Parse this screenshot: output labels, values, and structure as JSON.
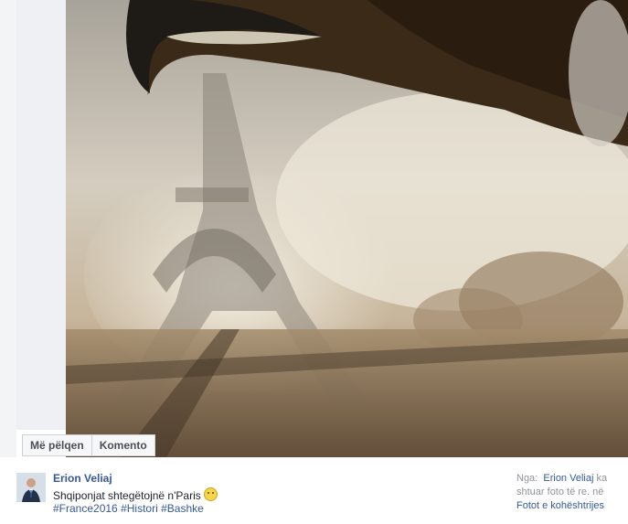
{
  "photo": {
    "description_alt": ""
  },
  "actions": {
    "like_label": "Më pëlqen",
    "comment_label": "Komento"
  },
  "post": {
    "author": "Erion Veliaj",
    "caption": "Shqiponjat shtegëtojnë n'Paris",
    "tags": [
      "#France2016",
      "#Histori",
      "#Bashke"
    ]
  },
  "source": {
    "label": "Nga:",
    "author": "Erion Veliaj",
    "text_mid": " ka shtuar",
    "text_mid2": " foto të re. ",
    "in_word": "në ",
    "album": "Fotot e kohështrijes"
  },
  "colors": {
    "link": "#365899",
    "text": "#1d2129",
    "muted": "#90949c"
  }
}
